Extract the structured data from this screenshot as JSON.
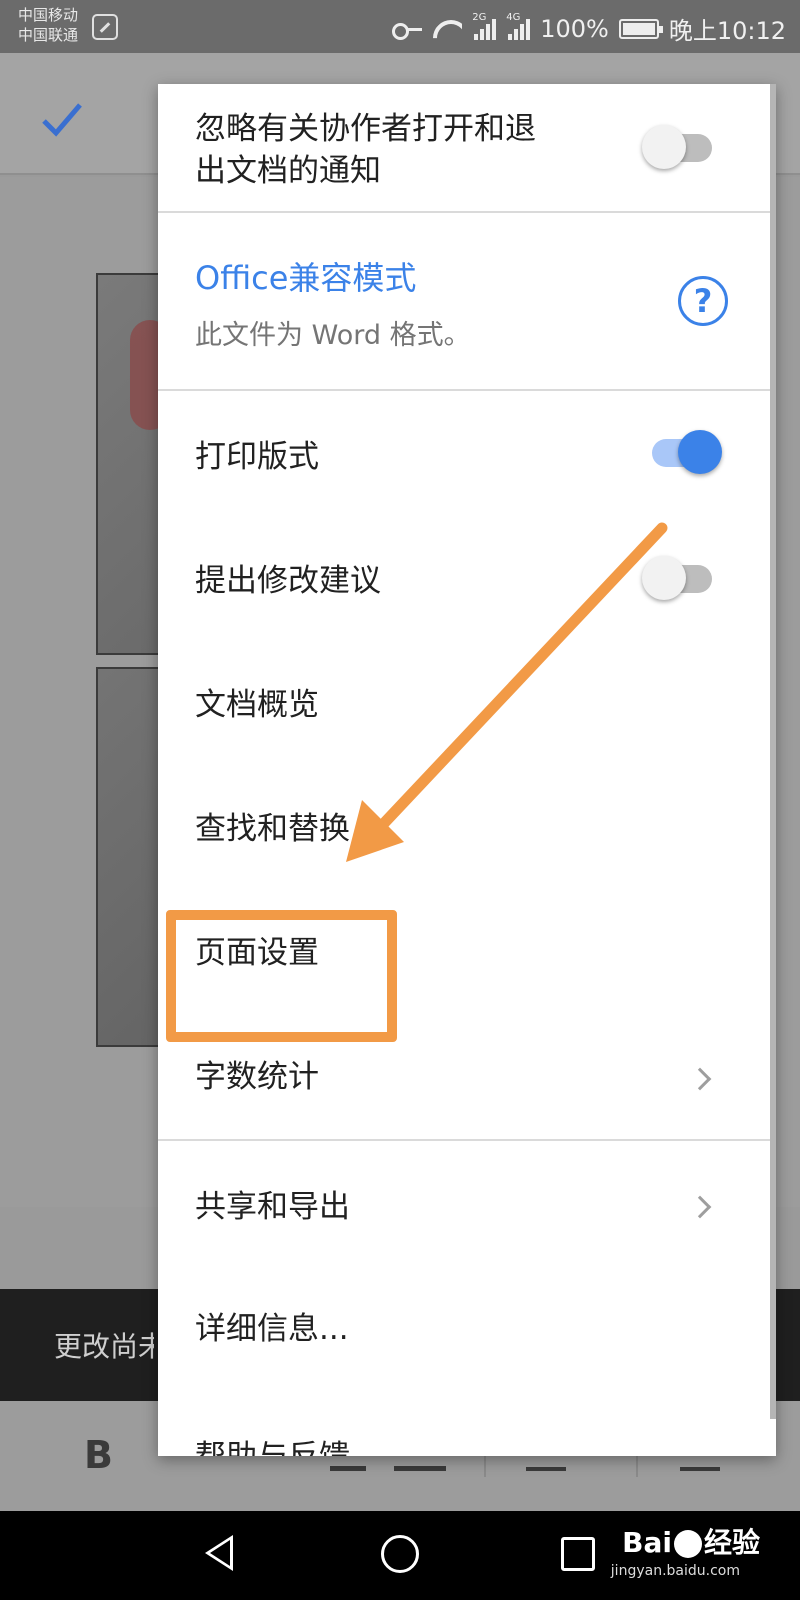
{
  "status_bar": {
    "carrier1": "中国移动",
    "carrier2": "中国联通",
    "net_2g": "2G",
    "net_4g": "4G",
    "battery": "100%",
    "time": "晚上10:12"
  },
  "background": {
    "snackbar_text": "更改尚未",
    "format_bold": "B",
    "colors": {
      "overlay": "#9a9a9a",
      "snackbar": "#1f1f1f",
      "accent": "#3b82e8"
    }
  },
  "menu": {
    "notify_toggle": {
      "label_line1": "忽略有关协作者打开和退",
      "label_line2": "出文档的通知",
      "on": false
    },
    "office_mode": {
      "title": "Office兼容模式",
      "subtitle": "此文件为 Word 格式。",
      "icon": "help-circle-icon"
    },
    "print_layout": {
      "label": "打印版式",
      "on": true
    },
    "suggest_changes": {
      "label": "提出修改建议",
      "on": false
    },
    "doc_outline": {
      "label": "文档概览"
    },
    "find_replace": {
      "label": "查找和替换..."
    },
    "page_setup": {
      "label": "页面设置"
    },
    "word_count": {
      "label": "字数统计"
    },
    "share_export": {
      "label": "共享和导出"
    },
    "details": {
      "label": "详细信息..."
    },
    "help": {
      "label": "帮助与反馈"
    }
  },
  "watermark": {
    "brand": "Bai",
    "brand2": "经验",
    "url": "jingyan.baidu.com"
  },
  "annotation": {
    "color": "#f29a46"
  }
}
